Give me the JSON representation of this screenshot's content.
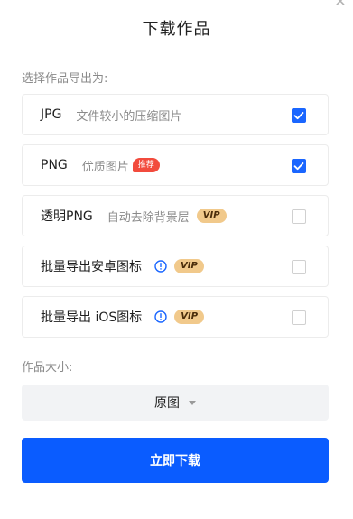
{
  "dialog": {
    "title": "下载作品",
    "close_icon": "close-icon"
  },
  "export_section": {
    "label": "选择作品导出为:",
    "options": [
      {
        "name": "JPG",
        "desc": "文件较小的压缩图片",
        "badge": "",
        "checked": true
      },
      {
        "name": "PNG",
        "desc": "优质图片",
        "badge": "推荐",
        "checked": true
      },
      {
        "name": "透明PNG",
        "desc": "自动去除背景层",
        "badge": "VIP",
        "checked": false
      },
      {
        "name": "批量导出安卓图标",
        "desc": "",
        "badge": "VIP",
        "info_icon": "info-icon",
        "checked": false
      },
      {
        "name": "批量导出 iOS图标",
        "desc": "",
        "badge": "VIP",
        "info_icon": "info-icon",
        "checked": false
      }
    ]
  },
  "size_section": {
    "label": "作品大小:",
    "selected": "原图"
  },
  "download_button": {
    "label": "立即下载"
  },
  "colors": {
    "primary": "#0a5cff",
    "checkbox_checked": "#1a66ff",
    "recommend_badge": "#f24b3d",
    "vip_badge": "#f1c98b",
    "info_icon": "#1a66ff"
  }
}
